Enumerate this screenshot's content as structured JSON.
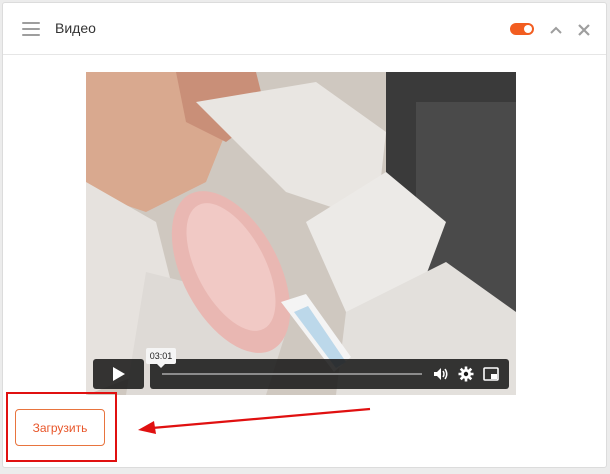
{
  "header": {
    "title": "Видео",
    "toggle_on": true
  },
  "video": {
    "time_tooltip": "03:01"
  },
  "upload": {
    "label": "Загрузить"
  },
  "colors": {
    "accent": "#f25d20",
    "annotation_red": "#e01010"
  },
  "icons": [
    "menu-icon",
    "toggle-switch",
    "chevron-up-icon",
    "close-icon",
    "play-icon",
    "volume-icon",
    "gear-icon",
    "picture-in-picture-icon"
  ]
}
